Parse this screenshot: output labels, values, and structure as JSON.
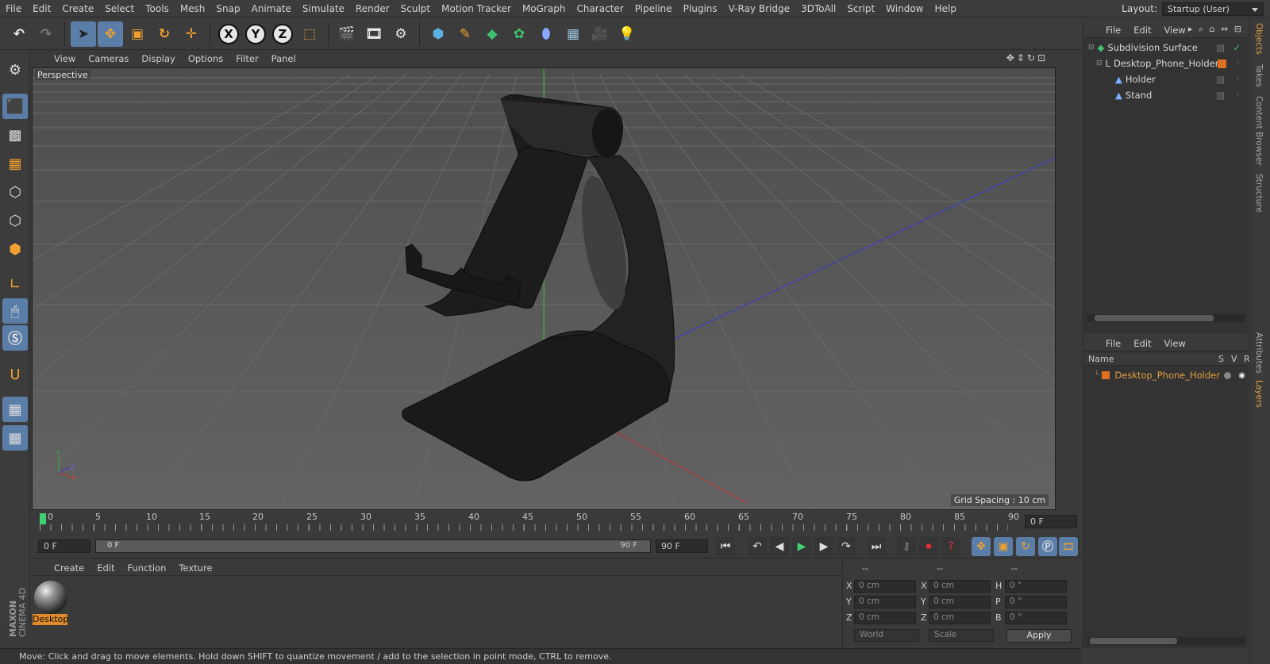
{
  "menubar": {
    "items": [
      "File",
      "Edit",
      "Create",
      "Select",
      "Tools",
      "Mesh",
      "Snap",
      "Animate",
      "Simulate",
      "Render",
      "Sculpt",
      "Motion Tracker",
      "MoGraph",
      "Character",
      "Pipeline",
      "Plugins",
      "V-Ray Bridge",
      "3DToAll",
      "Script",
      "Window",
      "Help"
    ],
    "layout_label": "Layout:",
    "layout_value": "Startup (User)"
  },
  "viewport": {
    "menu": [
      "View",
      "Cameras",
      "Display",
      "Options",
      "Filter",
      "Panel"
    ],
    "camera_label": "Perspective",
    "grid_spacing": "Grid Spacing : 10 cm",
    "axis_x": "X",
    "axis_y": "Y",
    "axis_z": "Z"
  },
  "timeline": {
    "ticks": [
      "0",
      "5",
      "10",
      "15",
      "20",
      "25",
      "30",
      "35",
      "40",
      "45",
      "50",
      "55",
      "60",
      "65",
      "70",
      "75",
      "80",
      "85",
      "90"
    ],
    "current_frame": "0 F"
  },
  "playbar": {
    "start_field": "0 F",
    "range_start": "0 F",
    "range_end": "90 F",
    "end_field": "90 F"
  },
  "material": {
    "menu": [
      "Create",
      "Edit",
      "Function",
      "Texture"
    ],
    "swatch_label": "Desktop"
  },
  "coords": {
    "header": [
      "--",
      "--",
      "--"
    ],
    "pos_x": "0 cm",
    "pos_y": "0 cm",
    "pos_z": "0 cm",
    "size_x": "0 cm",
    "size_y": "0 cm",
    "size_z": "0 cm",
    "rot_h": "0 °",
    "rot_p": "0 °",
    "rot_b": "0 °",
    "label_x": "X",
    "label_y": "Y",
    "label_z": "Z",
    "label_h": "H",
    "label_p": "P",
    "label_b": "B",
    "mode_world": "World",
    "mode_scale": "Scale",
    "apply": "Apply"
  },
  "status": {
    "text": "Move: Click and drag to move elements. Hold down SHIFT to quantize movement / add to the selection in point mode, CTRL to remove."
  },
  "objects": {
    "menu": [
      "File",
      "Edit",
      "View"
    ],
    "items": [
      {
        "label": "Subdivision Surface"
      },
      {
        "label": "Desktop_Phone_Holder"
      },
      {
        "label": "Holder"
      },
      {
        "label": "Stand"
      }
    ]
  },
  "layers": {
    "menu": [
      "File",
      "Edit",
      "View"
    ],
    "col_name": "Name",
    "col_s": "S",
    "col_v": "V",
    "col_r": "R",
    "item": "Desktop_Phone_Holder"
  },
  "sidetabs": [
    "Objects",
    "Takes",
    "Content Browser",
    "Structure",
    "Attributes",
    "Layers"
  ],
  "branding": {
    "maxon": "MAXON",
    "cinema": "CINEMA 4D"
  },
  "colors": {
    "accent_orange": "#e08a2a",
    "selected_blue": "#5a7ea8"
  }
}
